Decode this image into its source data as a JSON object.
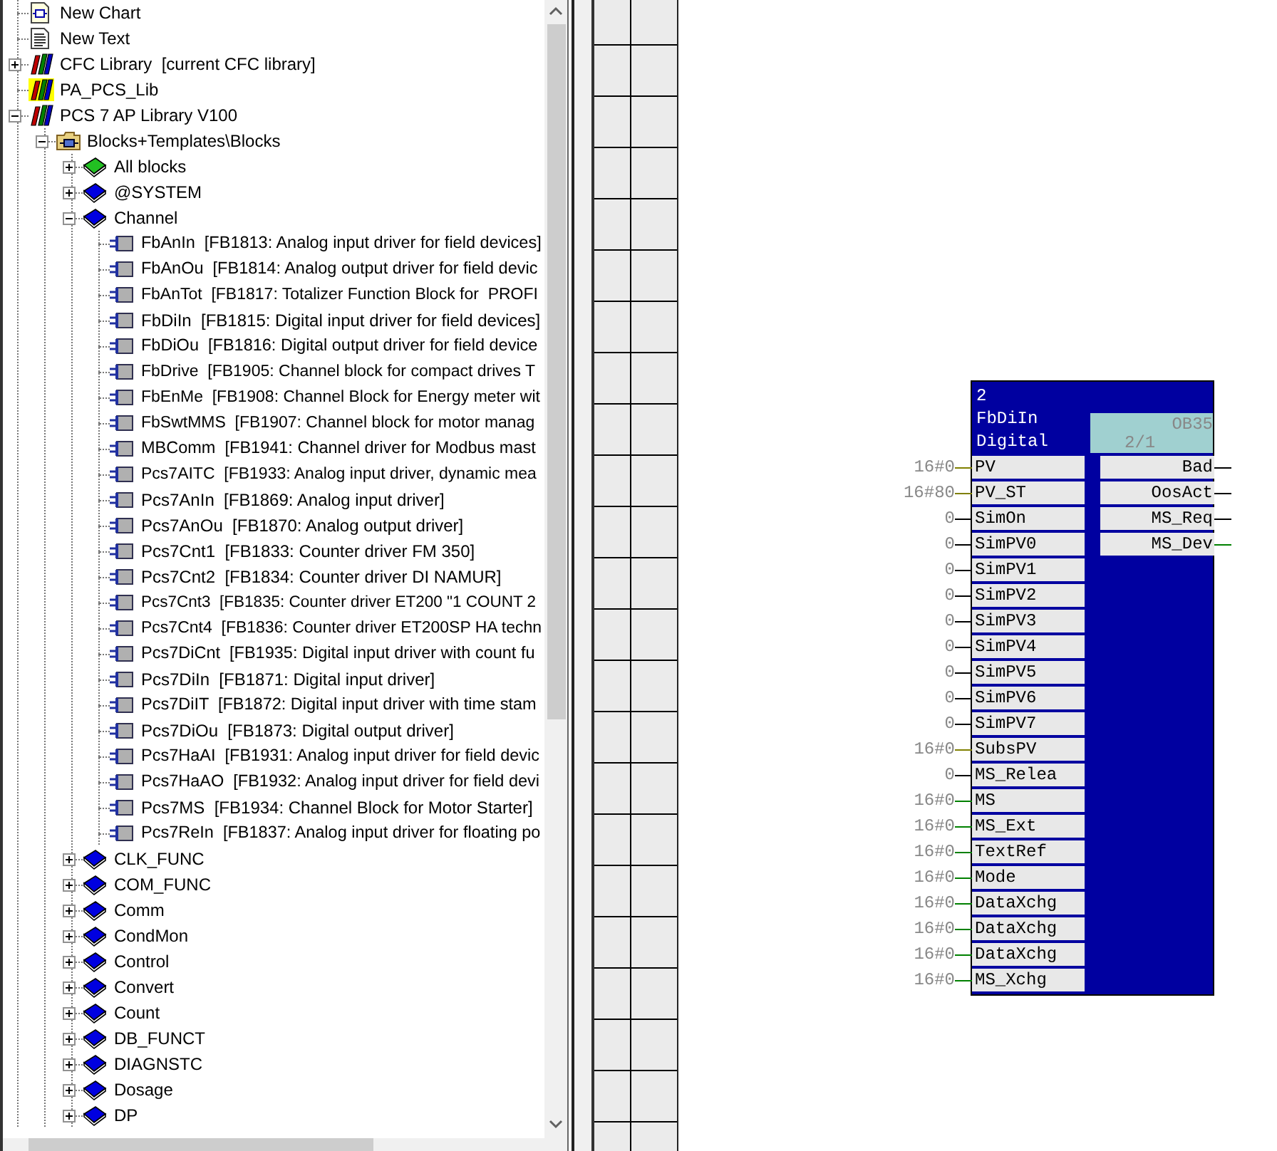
{
  "tree": [
    {
      "label": "New Chart",
      "kind": "chart"
    },
    {
      "label": "New Text",
      "kind": "text"
    },
    {
      "label": "CFC Library  [current CFC library]",
      "kind": "library",
      "highlighted": false,
      "expanded": false
    },
    {
      "label": "PA_PCS_Lib",
      "kind": "library",
      "highlighted": true
    },
    {
      "label": "PCS 7 AP Library V100",
      "kind": "library",
      "highlighted": false,
      "expanded": true,
      "children": [
        {
          "label": "Blocks+Templates\\Blocks",
          "kind": "folder",
          "expanded": true,
          "children": [
            {
              "label": "All blocks",
              "kind": "book",
              "color": "#22c022",
              "expanded": false
            },
            {
              "label": "@SYSTEM",
              "kind": "book",
              "color": "#0000e0",
              "expanded": false
            },
            {
              "label": "Channel",
              "kind": "book",
              "color": "#0000e0",
              "expanded": true,
              "children": [
                {
                  "label": "FbAnIn  [FB1813: Analog input driver for field devices]",
                  "kind": "block"
                },
                {
                  "label": "FbAnOu  [FB1814: Analog output driver for field devic",
                  "kind": "block"
                },
                {
                  "label": "FbAnTot  [FB1817: Totalizer Function Block for  PROFI",
                  "kind": "block"
                },
                {
                  "label": "FbDiIn  [FB1815: Digital input driver for field devices]",
                  "kind": "block"
                },
                {
                  "label": "FbDiOu  [FB1816: Digital output driver for field device",
                  "kind": "block"
                },
                {
                  "label": "FbDrive  [FB1905: Channel block for compact drives T",
                  "kind": "block"
                },
                {
                  "label": "FbEnMe  [FB1908: Channel Block for Energy meter wit",
                  "kind": "block"
                },
                {
                  "label": "FbSwtMMS  [FB1907: Channel block for motor manag",
                  "kind": "block"
                },
                {
                  "label": "MBComm  [FB1941: Channel driver for Modbus mast",
                  "kind": "block"
                },
                {
                  "label": "Pcs7AITC  [FB1933: Analog input driver, dynamic mea",
                  "kind": "block"
                },
                {
                  "label": "Pcs7AnIn  [FB1869: Analog input driver]",
                  "kind": "block"
                },
                {
                  "label": "Pcs7AnOu  [FB1870: Analog output driver]",
                  "kind": "block"
                },
                {
                  "label": "Pcs7Cnt1  [FB1833: Counter driver FM 350]",
                  "kind": "block"
                },
                {
                  "label": "Pcs7Cnt2  [FB1834: Counter driver DI NAMUR]",
                  "kind": "block"
                },
                {
                  "label": "Pcs7Cnt3  [FB1835: Counter driver ET200 \"1 COUNT 2",
                  "kind": "block"
                },
                {
                  "label": "Pcs7Cnt4  [FB1836: Counter driver ET200SP HA techn",
                  "kind": "block"
                },
                {
                  "label": "Pcs7DiCnt  [FB1935: Digital input driver with count fu",
                  "kind": "block"
                },
                {
                  "label": "Pcs7DiIn  [FB1871: Digital input driver]",
                  "kind": "block"
                },
                {
                  "label": "Pcs7DiIT  [FB1872: Digital input driver with time stam",
                  "kind": "block"
                },
                {
                  "label": "Pcs7DiOu  [FB1873: Digital output driver]",
                  "kind": "block"
                },
                {
                  "label": "Pcs7HaAI  [FB1931: Analog input driver for field devic",
                  "kind": "block"
                },
                {
                  "label": "Pcs7HaAO  [FB1932: Analog input driver for field devi",
                  "kind": "block"
                },
                {
                  "label": "Pcs7MS  [FB1934: Channel Block for Motor Starter]",
                  "kind": "block"
                },
                {
                  "label": "Pcs7ReIn  [FB1837: Analog input driver for floating po",
                  "kind": "block"
                }
              ]
            },
            {
              "label": "CLK_FUNC",
              "kind": "book",
              "color": "#0000e0",
              "expanded": false
            },
            {
              "label": "COM_FUNC",
              "kind": "book",
              "color": "#0000e0",
              "expanded": false
            },
            {
              "label": "Comm",
              "kind": "book",
              "color": "#0000e0",
              "expanded": false
            },
            {
              "label": "CondMon",
              "kind": "book",
              "color": "#0000e0",
              "expanded": false
            },
            {
              "label": "Control",
              "kind": "book",
              "color": "#0000e0",
              "expanded": false
            },
            {
              "label": "Convert",
              "kind": "book",
              "color": "#0000e0",
              "expanded": false
            },
            {
              "label": "Count",
              "kind": "book",
              "color": "#0000e0",
              "expanded": false
            },
            {
              "label": "DB_FUNCT",
              "kind": "book",
              "color": "#0000e0",
              "expanded": false
            },
            {
              "label": "DIAGNSTC",
              "kind": "book",
              "color": "#0000e0",
              "expanded": false
            },
            {
              "label": "Dosage",
              "kind": "book",
              "color": "#0000e0",
              "expanded": false
            },
            {
              "label": "DP",
              "kind": "book",
              "color": "#0000e0",
              "expanded": false
            }
          ]
        }
      ]
    }
  ],
  "block": {
    "number": "2",
    "name": "FbDiIn",
    "comment": "Digital",
    "run_sequence": {
      "task": "OB35",
      "position": "2/1"
    },
    "inputs": [
      {
        "name": "PV",
        "value": "16#0",
        "color": "#808000"
      },
      {
        "name": "PV_ST",
        "value": "16#80",
        "color": "#808000"
      },
      {
        "name": "SimOn",
        "value": "0",
        "color": "#000000"
      },
      {
        "name": "SimPV0",
        "value": "0",
        "color": "#000000"
      },
      {
        "name": "SimPV1",
        "value": "0",
        "color": "#000000"
      },
      {
        "name": "SimPV2",
        "value": "0",
        "color": "#000000"
      },
      {
        "name": "SimPV3",
        "value": "0",
        "color": "#000000"
      },
      {
        "name": "SimPV4",
        "value": "0",
        "color": "#000000"
      },
      {
        "name": "SimPV5",
        "value": "0",
        "color": "#000000"
      },
      {
        "name": "SimPV6",
        "value": "0",
        "color": "#000000"
      },
      {
        "name": "SimPV7",
        "value": "0",
        "color": "#000000"
      },
      {
        "name": "SubsPV",
        "value": "16#0",
        "color": "#808000"
      },
      {
        "name": "MS_Relea",
        "value": "0",
        "color": "#000000"
      },
      {
        "name": "MS",
        "value": "16#0",
        "color": "#008000"
      },
      {
        "name": "MS_Ext",
        "value": "16#0",
        "color": "#008000"
      },
      {
        "name": "TextRef",
        "value": "16#0",
        "color": "#008000"
      },
      {
        "name": "Mode",
        "value": "16#0",
        "color": "#008000"
      },
      {
        "name": "DataXchg",
        "value": "16#0",
        "color": "#008000"
      },
      {
        "name": "DataXchg",
        "value": "16#0",
        "color": "#008000"
      },
      {
        "name": "DataXchg",
        "value": "16#0",
        "color": "#008000"
      },
      {
        "name": "MS_Xchg",
        "value": "16#0",
        "color": "#008000"
      }
    ],
    "outputs": [
      {
        "name": "Bad",
        "color": "#000000"
      },
      {
        "name": "OosAct",
        "color": "#000000"
      },
      {
        "name": "MS_Req",
        "color": "#000000"
      },
      {
        "name": "MS_Dev",
        "color": "#008000"
      }
    ]
  }
}
